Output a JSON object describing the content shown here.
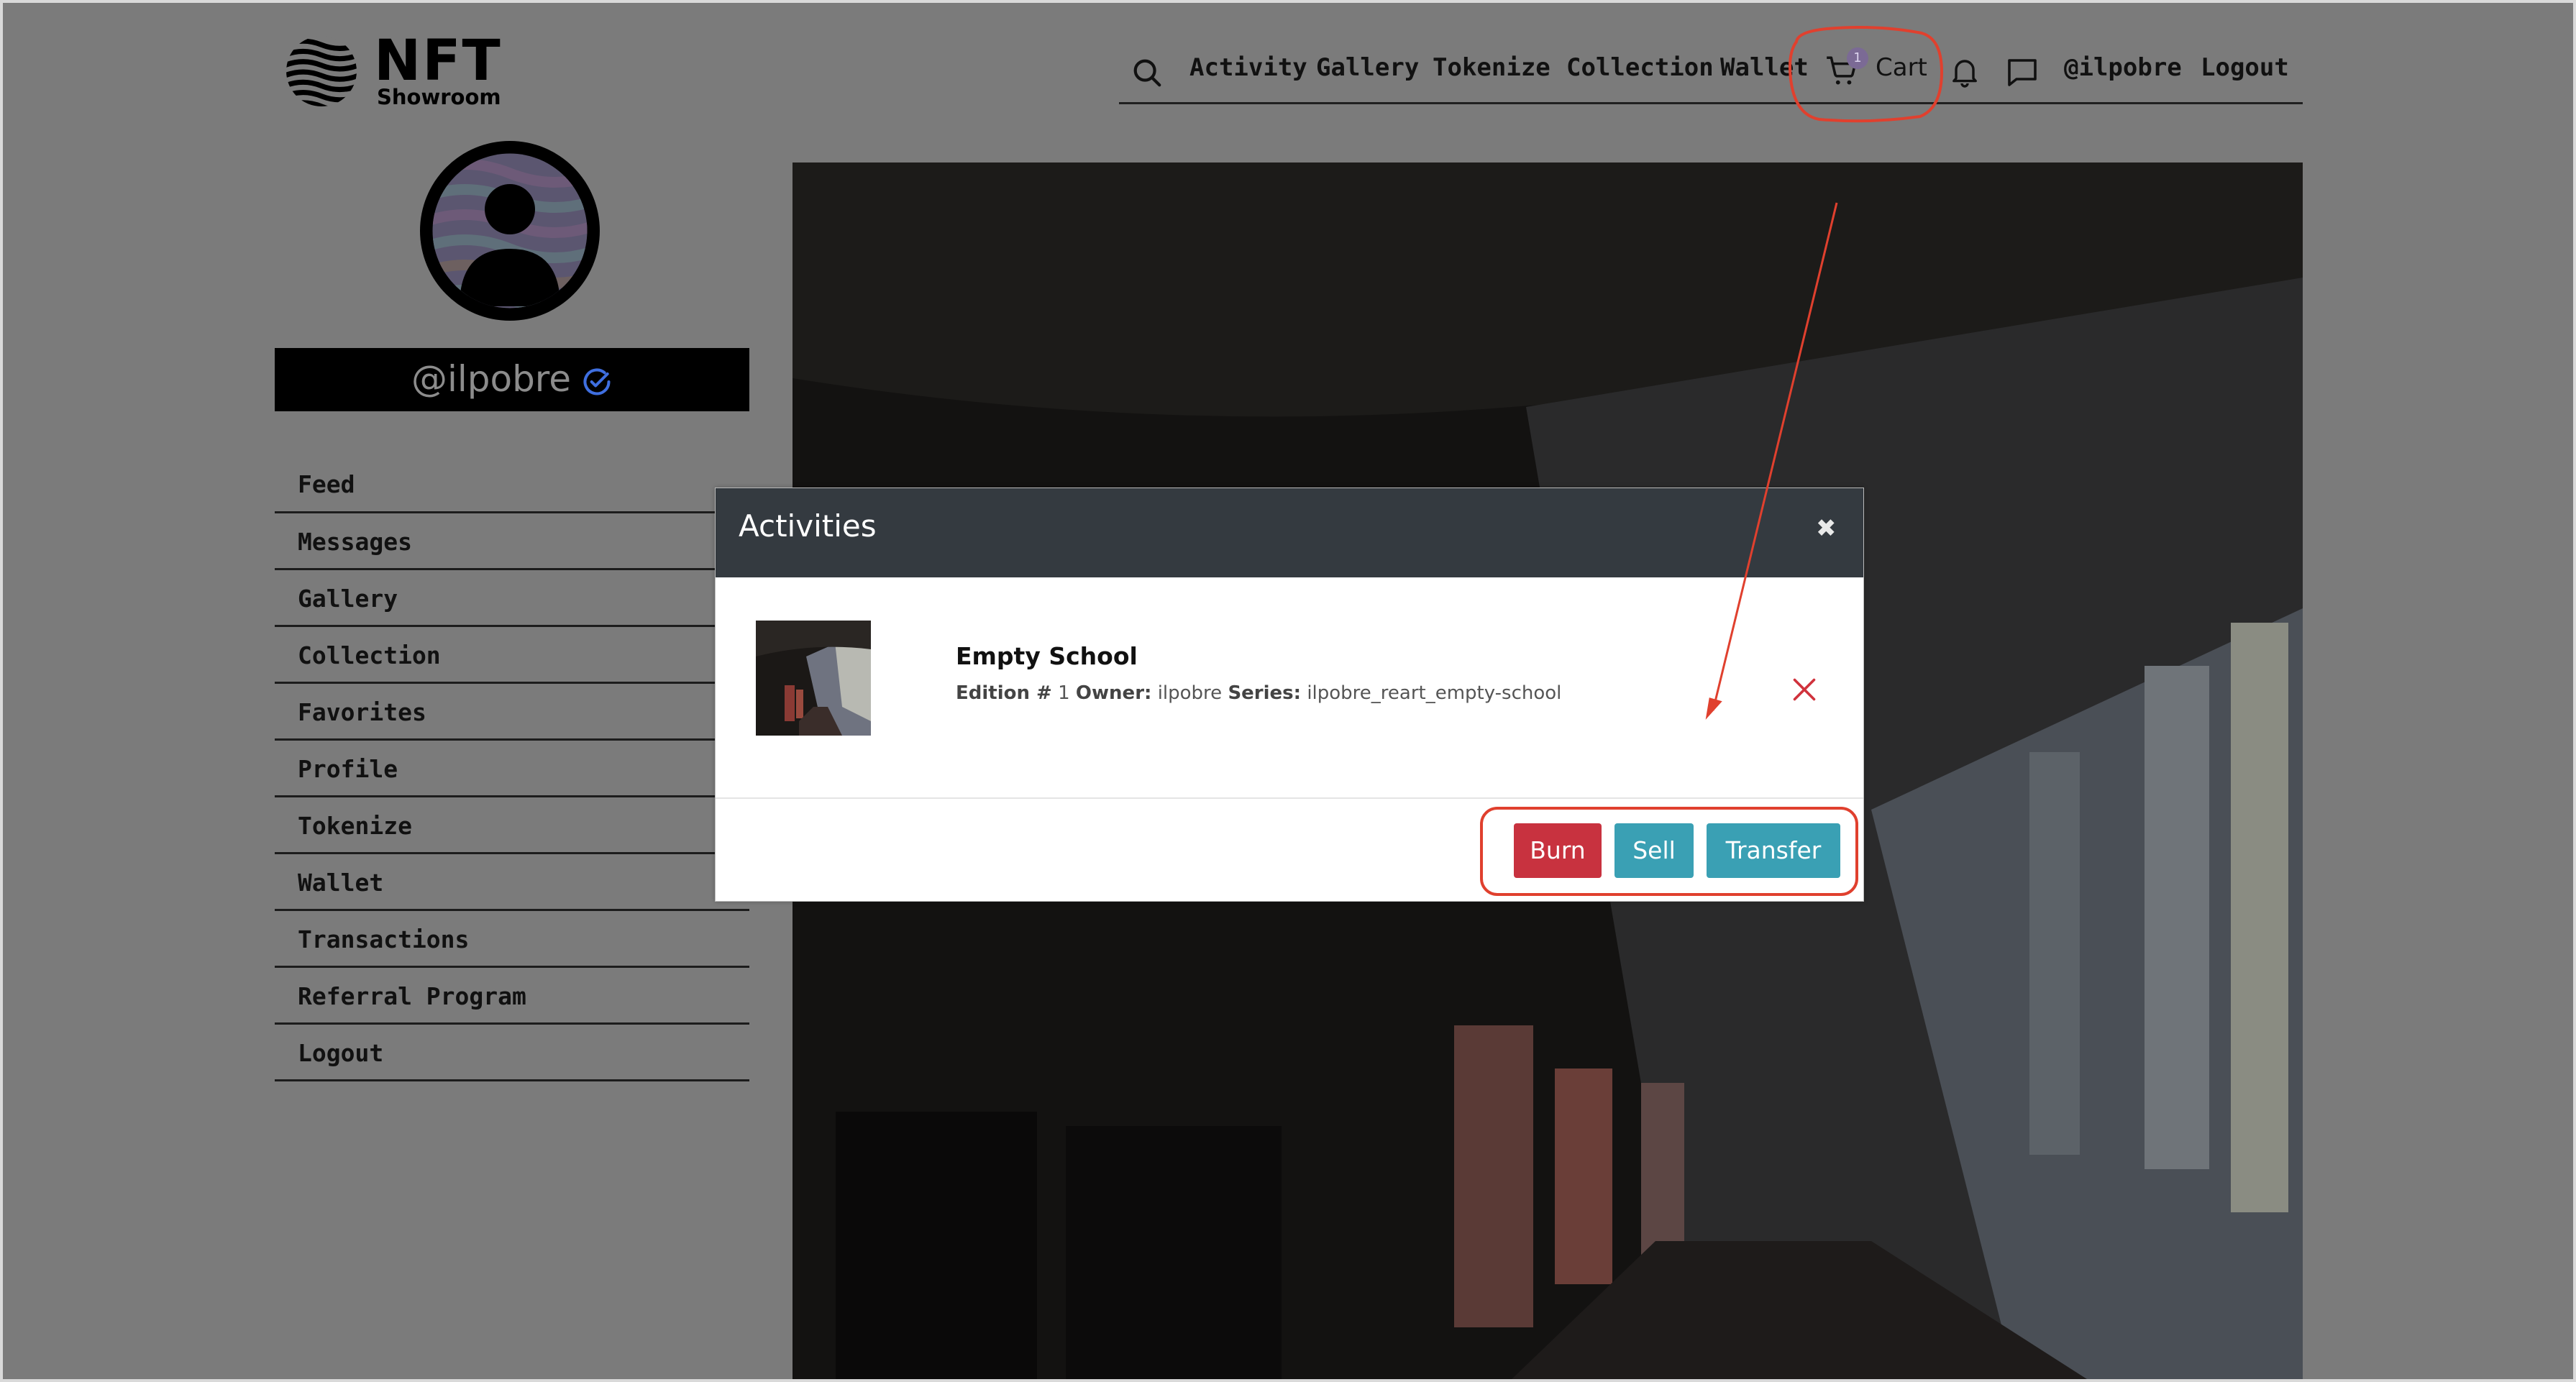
{
  "brand": {
    "name": "NFT",
    "tagline": "Showroom"
  },
  "topnav": {
    "items": [
      "Activity",
      "Gallery",
      "Tokenize",
      "Collection",
      "Wallet"
    ],
    "cart_label": "Cart",
    "cart_count": "1",
    "user": "@ilpobre",
    "logout": "Logout"
  },
  "profile": {
    "handle": "@ilpobre"
  },
  "sidebar": {
    "items": [
      "Feed",
      "Messages",
      "Gallery",
      "Collection",
      "Favorites",
      "Profile",
      "Tokenize",
      "Wallet",
      "Transactions",
      "Referral Program",
      "Logout"
    ]
  },
  "modal": {
    "title": "Activities",
    "close_glyph": "✖",
    "item": {
      "title": "Empty School",
      "edition_label": "Edition #",
      "edition": "1",
      "owner_label": "Owner:",
      "owner": "ilpobre",
      "series_label": "Series:",
      "series": "ilpobre_reart_empty-school"
    },
    "buttons": {
      "burn": "Burn",
      "sell": "Sell",
      "transfer": "Transfer"
    }
  },
  "colors": {
    "burn": "#c8323f",
    "accent": "#3aa0b4",
    "annotation": "#e0402e",
    "header": "#343a40"
  }
}
